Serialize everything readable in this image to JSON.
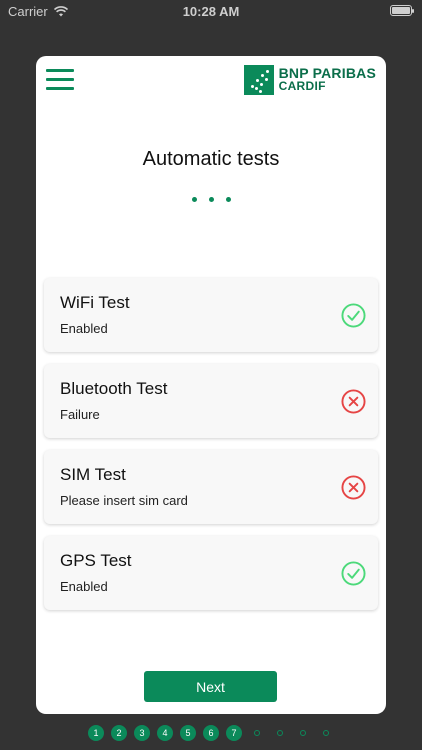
{
  "status_bar": {
    "carrier": "Carrier",
    "time": "10:28 AM"
  },
  "header": {
    "brand_line1": "BNP PARIBAS",
    "brand_line2": "CARDIF"
  },
  "page": {
    "title": "Automatic tests"
  },
  "tests": [
    {
      "name": "WiFi Test",
      "status": "Enabled",
      "result": "pass"
    },
    {
      "name": "Bluetooth Test",
      "status": "Failure",
      "result": "fail"
    },
    {
      "name": "SIM Test",
      "status": "Please insert sim card",
      "result": "fail"
    },
    {
      "name": "GPS Test",
      "status": "Enabled",
      "result": "pass"
    }
  ],
  "actions": {
    "next_label": "Next"
  },
  "pager": {
    "steps": [
      "1",
      "2",
      "3",
      "4",
      "5",
      "6",
      "7"
    ],
    "remaining_count": 4
  },
  "colors": {
    "brand": "#0b8a5a",
    "pass": "#4cd97a",
    "fail": "#e64545"
  }
}
